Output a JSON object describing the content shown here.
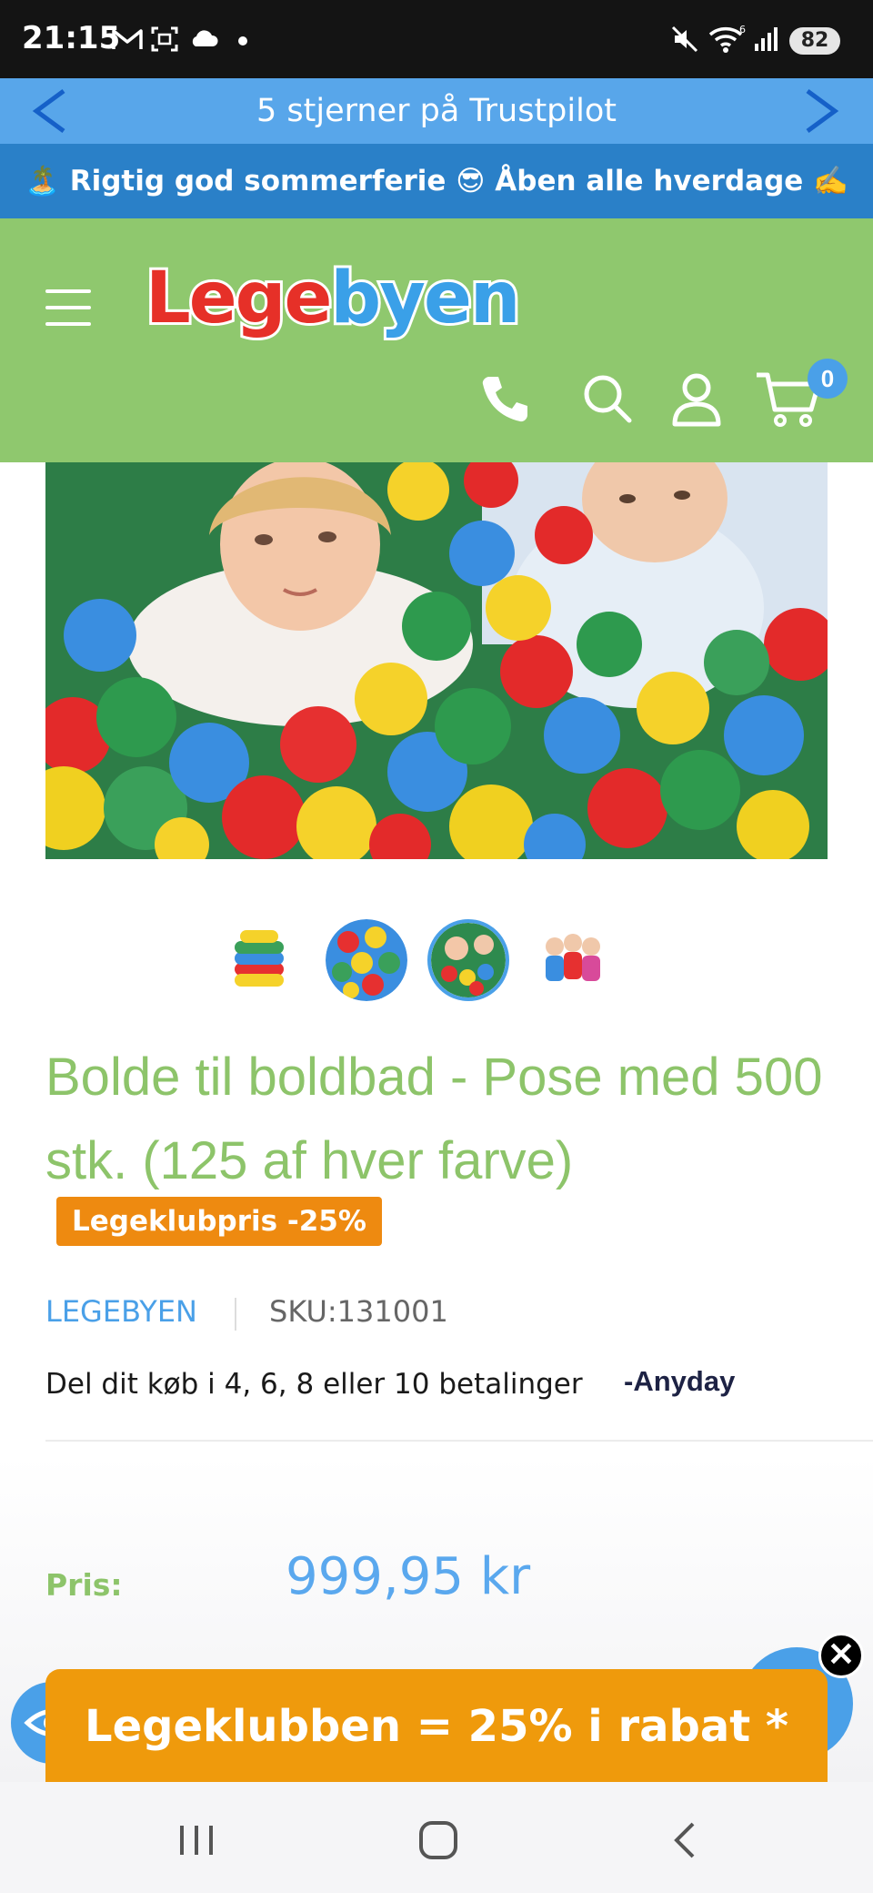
{
  "status_bar": {
    "time": "21:15",
    "battery": "82"
  },
  "trustpilot_bar": {
    "text": "5 stjerner på Trustpilot"
  },
  "announcement_bar": {
    "text": "🏝️ Rigtig god sommerferie 😎 Åben alle hverdage ✍️"
  },
  "header": {
    "logo": {
      "part1": "Lege",
      "part2": "by",
      "part3": "en"
    },
    "cart_count": "0",
    "icons": [
      "menu-icon",
      "phone-icon",
      "search-icon",
      "account-icon",
      "cart-icon"
    ]
  },
  "gallery": {
    "thumbnails": [
      "ball-bag-thumb",
      "balls-closeup-thumb",
      "kids-in-balls-thumb",
      "kids-group-thumb"
    ],
    "active_index": 2
  },
  "product": {
    "title": "Bolde til boldbad - Pose med 500 stk. (125 af hver farve)",
    "badge": "Legeklubpris -25%",
    "vendor": "LEGEBYEN",
    "sku": "SKU:131001",
    "installments_text": "Del dit køb i 4, 6, 8 eller 10 betalinger",
    "installments_logo": "Anyday",
    "price_label": "Pris:",
    "price": "999,95 kr"
  },
  "promo": {
    "text": "Legeklubben = 25% i rabat *",
    "close_label": "✕"
  },
  "colors": {
    "header_green": "#8fc86e",
    "accent_blue": "#4aa0e8",
    "promo_orange": "#ef9a0c",
    "title_green": "#8dc46a"
  }
}
